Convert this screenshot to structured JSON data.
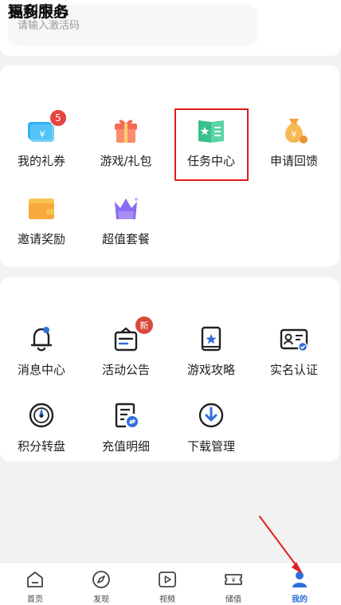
{
  "activation": {
    "placeholder": "请输入激活码"
  },
  "welfare": {
    "title": "福利中心",
    "items": [
      {
        "label": "我的礼券",
        "icon": "coupon-ticket-icon",
        "badge": "5"
      },
      {
        "label": "游戏/礼包",
        "icon": "gift-box-icon"
      },
      {
        "label": "任务中心",
        "icon": "task-book-icon"
      },
      {
        "label": "申请回馈",
        "icon": "money-bag-icon"
      },
      {
        "label": "邀请奖励",
        "icon": "wallet-icon"
      },
      {
        "label": "超值套餐",
        "icon": "package-crown-icon"
      }
    ]
  },
  "services": {
    "title": "更多服务",
    "items": [
      {
        "label": "消息中心",
        "icon": "bell-icon"
      },
      {
        "label": "活动公告",
        "icon": "announcement-icon",
        "badge": "新"
      },
      {
        "label": "游戏攻略",
        "icon": "guide-book-icon"
      },
      {
        "label": "实名认证",
        "icon": "id-card-icon"
      },
      {
        "label": "积分转盘",
        "icon": "spin-wheel-icon"
      },
      {
        "label": "充值明细",
        "icon": "recharge-detail-icon"
      },
      {
        "label": "下载管理",
        "icon": "download-icon"
      }
    ]
  },
  "tabbar": {
    "tabs": [
      {
        "label": "首页",
        "icon": "home-icon"
      },
      {
        "label": "发现",
        "icon": "compass-icon"
      },
      {
        "label": "视频",
        "icon": "video-play-icon"
      },
      {
        "label": "储值",
        "icon": "stored-value-ticket-icon"
      },
      {
        "label": "我的",
        "icon": "user-profile-icon",
        "active": true
      }
    ]
  },
  "colors": {
    "accent_blue": "#2f6fd9",
    "badge_red": "#e7433e",
    "highlight_red": "#e01b1b",
    "annotation_arrow": "#e02020"
  }
}
